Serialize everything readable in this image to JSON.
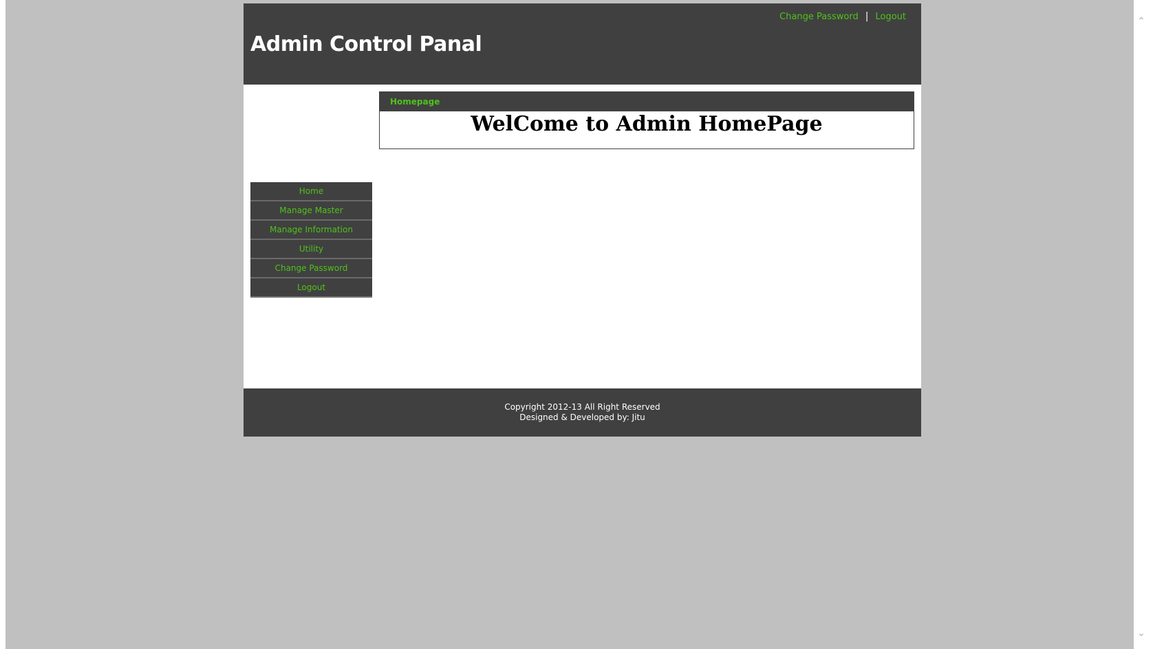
{
  "header": {
    "title": "Admin Control Panal",
    "links": {
      "change_password": "Change Password",
      "separator": "|",
      "logout": "Logout"
    }
  },
  "sidebar": {
    "items": [
      {
        "label": "Home"
      },
      {
        "label": "Manage Master"
      },
      {
        "label": "Manage Information"
      },
      {
        "label": "Utility"
      },
      {
        "label": "Change Password"
      },
      {
        "label": "Logout"
      }
    ]
  },
  "main": {
    "panel_title": "Homepage",
    "welcome_text": "WelCome to Admin HomePage"
  },
  "footer": {
    "copyright": "Copyright 2012-13 All Right Reserved",
    "credit": "Designed & Developed by: Jitu"
  },
  "scrollbar": {
    "up_icon": "chevron-up-icon",
    "down_icon": "chevron-down-icon"
  },
  "colors": {
    "accent": "#4ec21a",
    "header_bg": "#404040",
    "page_bg": "#c0c0c0"
  }
}
